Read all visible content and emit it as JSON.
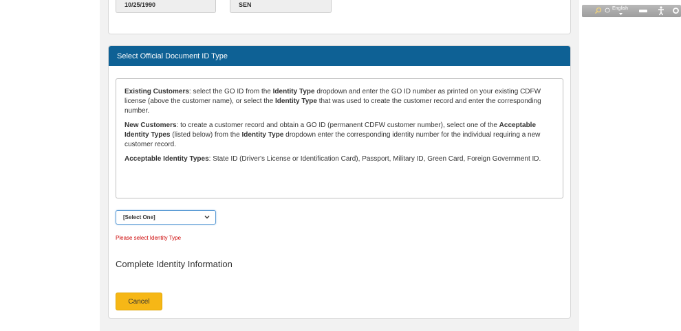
{
  "top_fields": {
    "dob_value": "10/25/1990",
    "suffix_value": "SEN"
  },
  "document_section": {
    "header": "Select Official Document ID Type",
    "existing": {
      "label": "Existing Customers",
      "text_1": ": select the GO ID from the ",
      "bold_1": "Identity Type",
      "text_2": " dropdown and enter the GO ID number as printed on your existing CDFW license (above the customer name), or select the ",
      "bold_2": "Identity Type",
      "text_3": " that was used to create the customer record and enter the corresponding number."
    },
    "new": {
      "label": "New Customers",
      "text_1": ": to create a customer record and obtain a GO ID (permanent CDFW customer number), select one of the ",
      "bold_1": "Acceptable Identity Types",
      "text_2": " (listed below) from the ",
      "bold_2": "Identity Type",
      "text_3": " dropdown enter the corresponding identity number for the individual requiring a new customer record."
    },
    "acceptable": {
      "label": "Acceptable Identity Types",
      "text": ": State ID (Driver's License or Identification Card), Passport, Military ID, Green Card, Foreign Government ID."
    },
    "identity_select_value": "[Select One]",
    "error_message": "Please select Identity Type",
    "complete_title": "Complete Identity Information",
    "cancel_label": "Cancel"
  },
  "toolbar": {
    "language_label": "English",
    "icons": [
      "search-icon",
      "globe-icon",
      "minus-icon",
      "accessibility-icon",
      "gear-icon"
    ]
  },
  "colors": {
    "header_blue": "#0e6195",
    "cancel_yellow": "#f6b716",
    "error_red": "#cc0000"
  }
}
